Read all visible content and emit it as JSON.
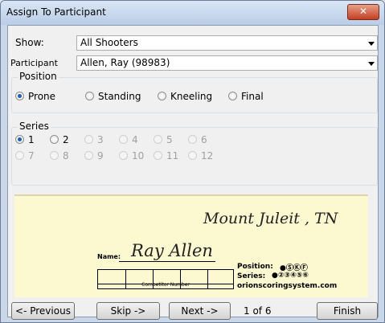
{
  "window": {
    "title": "Assign To Participant",
    "close_label": "✕"
  },
  "show": {
    "label": "Show:",
    "value": "All Shooters"
  },
  "participant": {
    "label": "Participant",
    "value": "Allen, Ray (98983)"
  },
  "position": {
    "title": "Position",
    "options": [
      {
        "label": "Prone",
        "checked": true
      },
      {
        "label": "Standing",
        "checked": false
      },
      {
        "label": "Kneeling",
        "checked": false
      },
      {
        "label": "Final",
        "checked": false
      }
    ]
  },
  "series": {
    "title": "Series",
    "options": [
      "1",
      "2",
      "3",
      "4",
      "5",
      "6",
      "7",
      "8",
      "9",
      "10",
      "11",
      "12"
    ],
    "selected": "1",
    "enabled": [
      "1",
      "2"
    ]
  },
  "card": {
    "location": "Mount Juleit , TN",
    "name_label": "Name:",
    "name": "Ray Allen",
    "competitor_label": "Competitor Number",
    "position_label": "Position:",
    "position_marks": "●ⓈⓀⒻ",
    "series_label": "Series:",
    "series_marks": "●②③④⑤⑥",
    "site": "orionscoringsystem.com"
  },
  "footer": {
    "previous_label": "<- Previous",
    "skip_label": "Skip ->",
    "next_label": "Next ->",
    "counter": "1 of 6",
    "finish_label": "Finish"
  }
}
